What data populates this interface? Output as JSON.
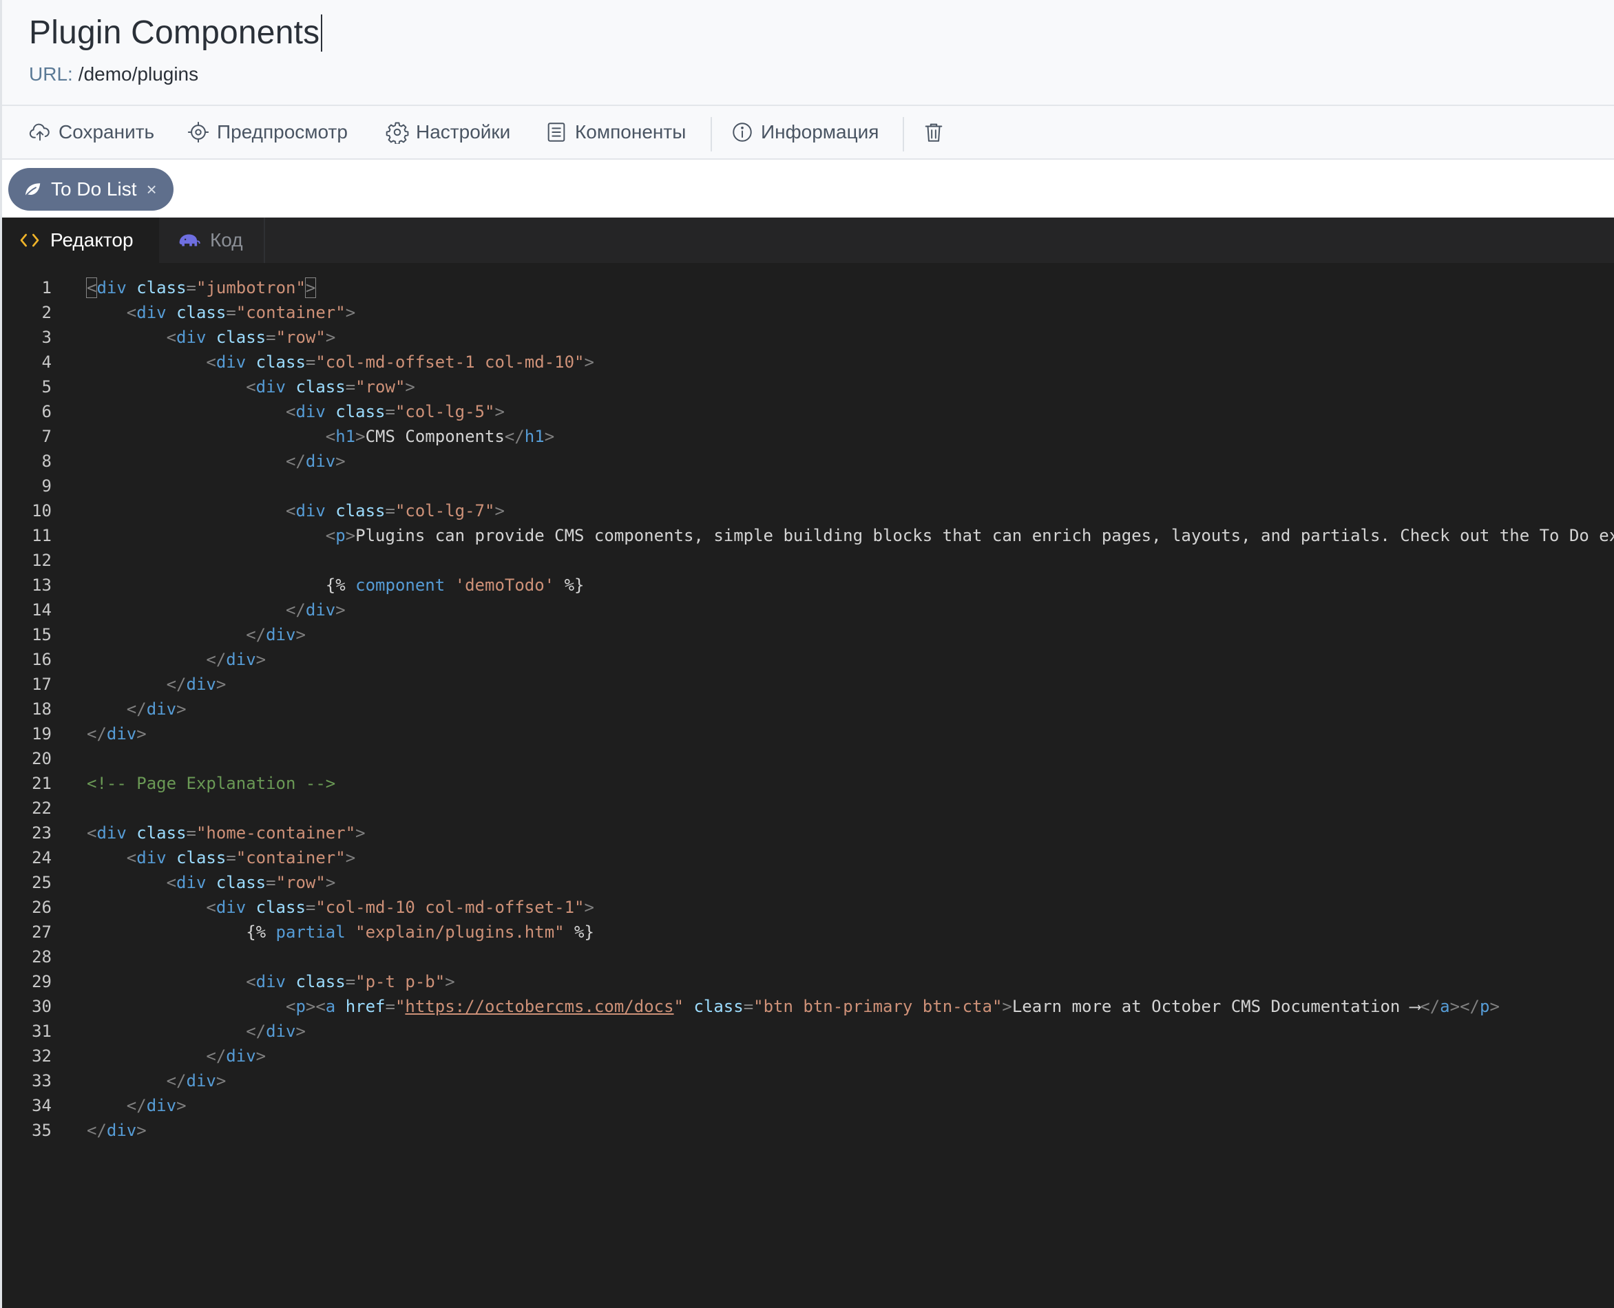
{
  "page": {
    "title": "Plugin Components",
    "url_label": "URL:",
    "url_value": "/demo/plugins"
  },
  "toolbar": {
    "save": "Сохранить",
    "preview": "Предпросмотр",
    "settings": "Настройки",
    "components": "Компоненты",
    "info": "Информация",
    "delete_icon": "trash-icon"
  },
  "components": {
    "chips": [
      {
        "label": "To Do List",
        "close": "×"
      }
    ]
  },
  "editor": {
    "tabs": [
      {
        "label": "Редактор",
        "active": true,
        "icon": "code-icon"
      },
      {
        "label": "Код",
        "active": false,
        "icon": "php-elephant-icon"
      }
    ],
    "colors": {
      "background": "#1e1e1e",
      "tag": "#569cd6",
      "attribute": "#9cdcfe",
      "string": "#ce9178",
      "comment": "#6a9955",
      "text": "#d4d4d4"
    },
    "lines": [
      [
        [
          "b",
          "<"
        ],
        [
          "tag",
          "div"
        ],
        [
          "t",
          " "
        ],
        [
          "a",
          "class"
        ],
        [
          "b",
          "="
        ],
        [
          "s",
          "\"jumbotron\""
        ],
        [
          "b",
          ">"
        ]
      ],
      [
        [
          "t",
          "    "
        ],
        [
          "b",
          "<"
        ],
        [
          "tag",
          "div"
        ],
        [
          "t",
          " "
        ],
        [
          "a",
          "class"
        ],
        [
          "b",
          "="
        ],
        [
          "s",
          "\"container\""
        ],
        [
          "b",
          ">"
        ]
      ],
      [
        [
          "t",
          "        "
        ],
        [
          "b",
          "<"
        ],
        [
          "tag",
          "div"
        ],
        [
          "t",
          " "
        ],
        [
          "a",
          "class"
        ],
        [
          "b",
          "="
        ],
        [
          "s",
          "\"row\""
        ],
        [
          "b",
          ">"
        ]
      ],
      [
        [
          "t",
          "            "
        ],
        [
          "b",
          "<"
        ],
        [
          "tag",
          "div"
        ],
        [
          "t",
          " "
        ],
        [
          "a",
          "class"
        ],
        [
          "b",
          "="
        ],
        [
          "s",
          "\"col-md-offset-1 col-md-10\""
        ],
        [
          "b",
          ">"
        ]
      ],
      [
        [
          "t",
          "                "
        ],
        [
          "b",
          "<"
        ],
        [
          "tag",
          "div"
        ],
        [
          "t",
          " "
        ],
        [
          "a",
          "class"
        ],
        [
          "b",
          "="
        ],
        [
          "s",
          "\"row\""
        ],
        [
          "b",
          ">"
        ]
      ],
      [
        [
          "t",
          "                    "
        ],
        [
          "b",
          "<"
        ],
        [
          "tag",
          "div"
        ],
        [
          "t",
          " "
        ],
        [
          "a",
          "class"
        ],
        [
          "b",
          "="
        ],
        [
          "s",
          "\"col-lg-5\""
        ],
        [
          "b",
          ">"
        ]
      ],
      [
        [
          "t",
          "                        "
        ],
        [
          "b",
          "<"
        ],
        [
          "tag",
          "h1"
        ],
        [
          "b",
          ">"
        ],
        [
          "t",
          "CMS Components"
        ],
        [
          "b",
          "</"
        ],
        [
          "tag",
          "h1"
        ],
        [
          "b",
          ">"
        ]
      ],
      [
        [
          "t",
          "                    "
        ],
        [
          "b",
          "</"
        ],
        [
          "tag",
          "div"
        ],
        [
          "b",
          ">"
        ]
      ],
      [],
      [
        [
          "t",
          "                    "
        ],
        [
          "b",
          "<"
        ],
        [
          "tag",
          "div"
        ],
        [
          "t",
          " "
        ],
        [
          "a",
          "class"
        ],
        [
          "b",
          "="
        ],
        [
          "s",
          "\"col-lg-7\""
        ],
        [
          "b",
          ">"
        ]
      ],
      [
        [
          "t",
          "                        "
        ],
        [
          "b",
          "<"
        ],
        [
          "tag",
          "p"
        ],
        [
          "b",
          ">"
        ],
        [
          "t",
          "Plugins can provide CMS components, simple building blocks that can enrich pages, layouts, and partials. Check out the To Do ex"
        ]
      ],
      [],
      [
        [
          "t",
          "                        {% "
        ],
        [
          "k",
          "component"
        ],
        [
          "t",
          " "
        ],
        [
          "s",
          "'demoTodo'"
        ],
        [
          "t",
          " %}"
        ]
      ],
      [
        [
          "t",
          "                    "
        ],
        [
          "b",
          "</"
        ],
        [
          "tag",
          "div"
        ],
        [
          "b",
          ">"
        ]
      ],
      [
        [
          "t",
          "                "
        ],
        [
          "b",
          "</"
        ],
        [
          "tag",
          "div"
        ],
        [
          "b",
          ">"
        ]
      ],
      [
        [
          "t",
          "            "
        ],
        [
          "b",
          "</"
        ],
        [
          "tag",
          "div"
        ],
        [
          "b",
          ">"
        ]
      ],
      [
        [
          "t",
          "        "
        ],
        [
          "b",
          "</"
        ],
        [
          "tag",
          "div"
        ],
        [
          "b",
          ">"
        ]
      ],
      [
        [
          "t",
          "    "
        ],
        [
          "b",
          "</"
        ],
        [
          "tag",
          "div"
        ],
        [
          "b",
          ">"
        ]
      ],
      [
        [
          "b",
          "</"
        ],
        [
          "tag",
          "div"
        ],
        [
          "b",
          ">"
        ]
      ],
      [],
      [
        [
          "c",
          "<!-- Page Explanation -->"
        ]
      ],
      [],
      [
        [
          "b",
          "<"
        ],
        [
          "tag",
          "div"
        ],
        [
          "t",
          " "
        ],
        [
          "a",
          "class"
        ],
        [
          "b",
          "="
        ],
        [
          "s",
          "\"home-container\""
        ],
        [
          "b",
          ">"
        ]
      ],
      [
        [
          "t",
          "    "
        ],
        [
          "b",
          "<"
        ],
        [
          "tag",
          "div"
        ],
        [
          "t",
          " "
        ],
        [
          "a",
          "class"
        ],
        [
          "b",
          "="
        ],
        [
          "s",
          "\"container\""
        ],
        [
          "b",
          ">"
        ]
      ],
      [
        [
          "t",
          "        "
        ],
        [
          "b",
          "<"
        ],
        [
          "tag",
          "div"
        ],
        [
          "t",
          " "
        ],
        [
          "a",
          "class"
        ],
        [
          "b",
          "="
        ],
        [
          "s",
          "\"row\""
        ],
        [
          "b",
          ">"
        ]
      ],
      [
        [
          "t",
          "            "
        ],
        [
          "b",
          "<"
        ],
        [
          "tag",
          "div"
        ],
        [
          "t",
          " "
        ],
        [
          "a",
          "class"
        ],
        [
          "b",
          "="
        ],
        [
          "s",
          "\"col-md-10 col-md-offset-1\""
        ],
        [
          "b",
          ">"
        ]
      ],
      [
        [
          "t",
          "                {% "
        ],
        [
          "k",
          "partial"
        ],
        [
          "t",
          " "
        ],
        [
          "s",
          "\"explain/plugins.htm\""
        ],
        [
          "t",
          " %}"
        ]
      ],
      [],
      [
        [
          "t",
          "                "
        ],
        [
          "b",
          "<"
        ],
        [
          "tag",
          "div"
        ],
        [
          "t",
          " "
        ],
        [
          "a",
          "class"
        ],
        [
          "b",
          "="
        ],
        [
          "s",
          "\"p-t p-b\""
        ],
        [
          "b",
          ">"
        ]
      ],
      [
        [
          "t",
          "                    "
        ],
        [
          "b",
          "<"
        ],
        [
          "tag",
          "p"
        ],
        [
          "b",
          "><"
        ],
        [
          "tag",
          "a"
        ],
        [
          "t",
          " "
        ],
        [
          "a",
          "href"
        ],
        [
          "b",
          "="
        ],
        [
          "s",
          "\""
        ],
        [
          "l",
          "https://octobercms.com/docs"
        ],
        [
          "s",
          "\""
        ],
        [
          "t",
          " "
        ],
        [
          "a",
          "class"
        ],
        [
          "b",
          "="
        ],
        [
          "s",
          "\"btn btn-primary btn-cta\""
        ],
        [
          "b",
          ">"
        ],
        [
          "t",
          "Learn more at October CMS Documentation ⟶"
        ],
        [
          "b",
          "</"
        ],
        [
          "tag",
          "a"
        ],
        [
          "b",
          "></"
        ],
        [
          "tag",
          "p"
        ],
        [
          "b",
          ">"
        ]
      ],
      [
        [
          "t",
          "                "
        ],
        [
          "b",
          "</"
        ],
        [
          "tag",
          "div"
        ],
        [
          "b",
          ">"
        ]
      ],
      [
        [
          "t",
          "            "
        ],
        [
          "b",
          "</"
        ],
        [
          "tag",
          "div"
        ],
        [
          "b",
          ">"
        ]
      ],
      [
        [
          "t",
          "        "
        ],
        [
          "b",
          "</"
        ],
        [
          "tag",
          "div"
        ],
        [
          "b",
          ">"
        ]
      ],
      [
        [
          "t",
          "    "
        ],
        [
          "b",
          "</"
        ],
        [
          "tag",
          "div"
        ],
        [
          "b",
          ">"
        ]
      ],
      [
        [
          "b",
          "</"
        ],
        [
          "tag",
          "div"
        ],
        [
          "b",
          ">"
        ]
      ]
    ]
  }
}
